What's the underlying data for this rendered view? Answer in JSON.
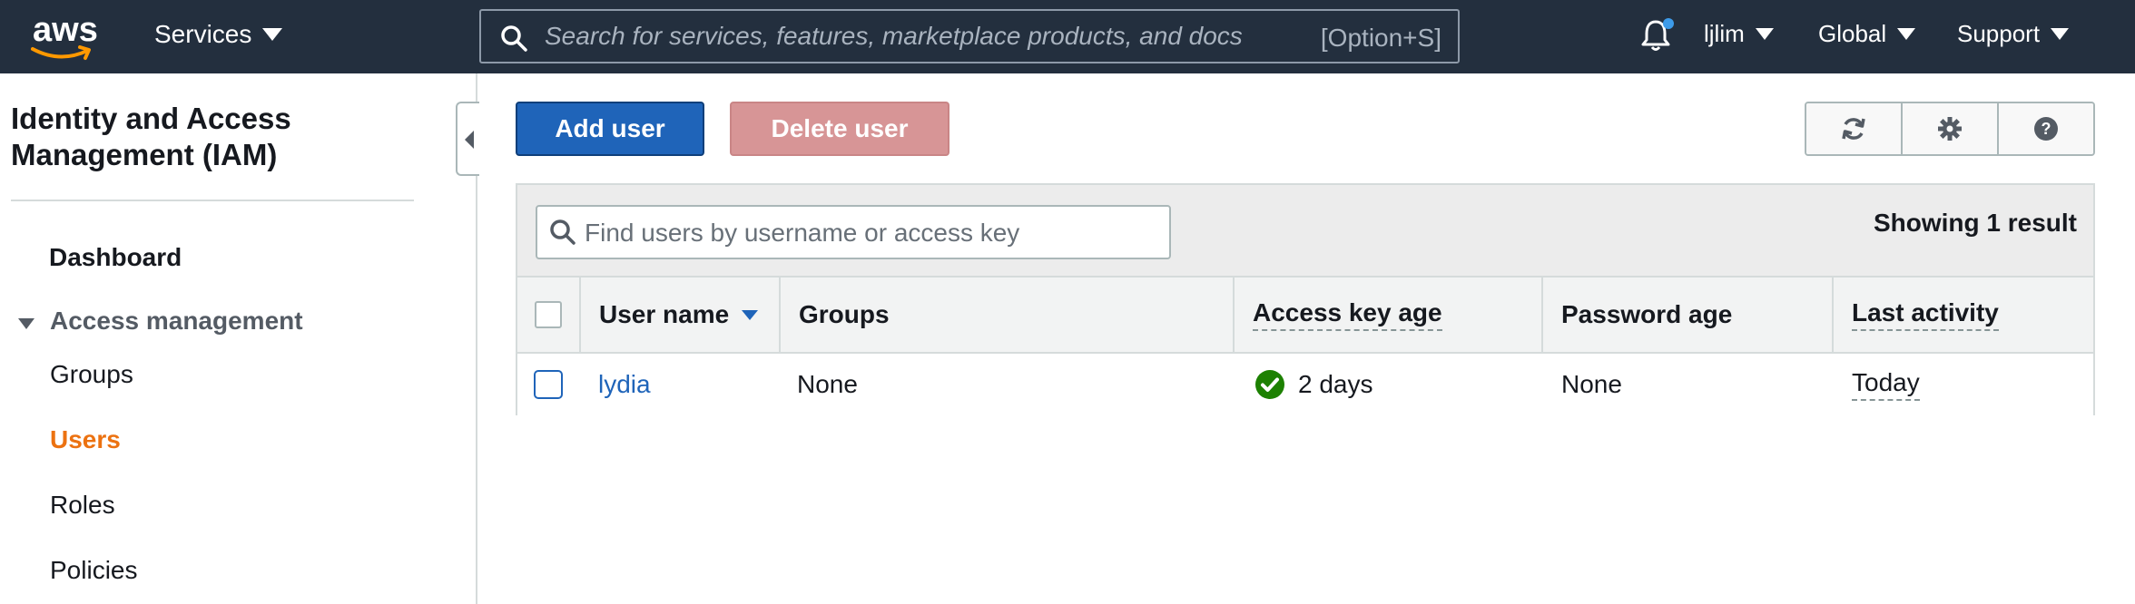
{
  "topbar": {
    "logo_text": "aws",
    "services_label": "Services",
    "search_placeholder": "Search for services, features, marketplace products, and docs",
    "search_shortcut": "[Option+S]",
    "account_label": "ljlim",
    "region_label": "Global",
    "support_label": "Support",
    "bg_color": "#232f3e"
  },
  "sidebar": {
    "title": "Identity and Access Management (IAM)",
    "items": [
      {
        "label": "Dashboard"
      },
      {
        "label": "Access management"
      },
      {
        "label": "Groups"
      },
      {
        "label": "Users"
      },
      {
        "label": "Roles"
      },
      {
        "label": "Policies"
      }
    ],
    "active_color": "#ec7211"
  },
  "toolbar": {
    "add_user_label": "Add user",
    "delete_user_label": "Delete user",
    "icons": [
      "refresh-icon",
      "gear-icon",
      "help-icon"
    ]
  },
  "filter": {
    "placeholder": "Find users by username or access key",
    "result_text": "Showing 1 result"
  },
  "table": {
    "columns": [
      "User name",
      "Groups",
      "Access key age",
      "Password age",
      "Last activity"
    ],
    "rows": [
      {
        "user_name": "lydia",
        "groups": "None",
        "access_key_age": "2 days",
        "password_age": "None",
        "last_activity": "Today"
      }
    ]
  }
}
